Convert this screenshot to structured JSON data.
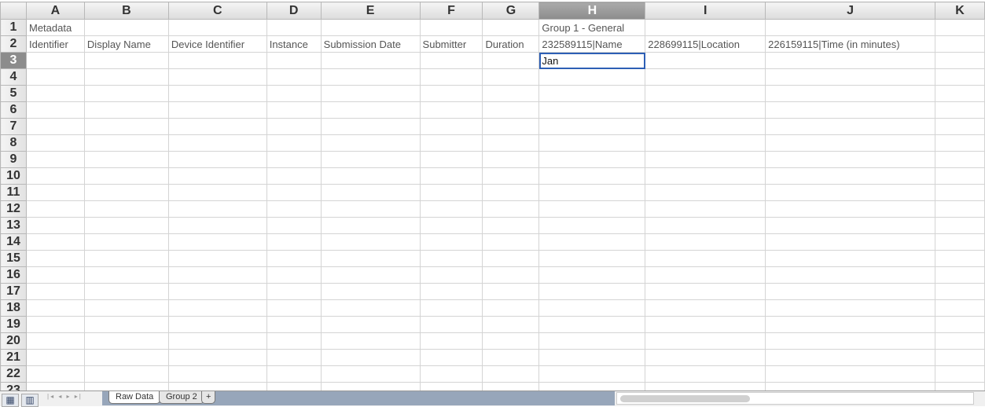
{
  "columns": [
    "A",
    "B",
    "C",
    "D",
    "E",
    "F",
    "G",
    "H",
    "I",
    "J",
    "K"
  ],
  "selected_column": "H",
  "rows": {
    "1": {
      "A": "Metadata",
      "H": "Group 1 - General"
    },
    "2": {
      "A": "Identifier",
      "B": "Display Name",
      "C": "Device Identifier",
      "D": "Instance",
      "E": "Submission Date",
      "F": "Submitter",
      "G": "Duration",
      "H": "232589115|Name",
      "I": "228699115|Location",
      "J": "226159115|Time (in minutes)"
    },
    "3": {
      "H": "Jan"
    }
  },
  "row_count": 23,
  "active_cell": "H3",
  "sheet_tabs": [
    {
      "label": "Raw Data",
      "active": true
    },
    {
      "label": "Group 2",
      "active": false
    }
  ],
  "add_sheet_label": "+",
  "nav_arrows": "|◂ ◂ ▸ ▸|"
}
